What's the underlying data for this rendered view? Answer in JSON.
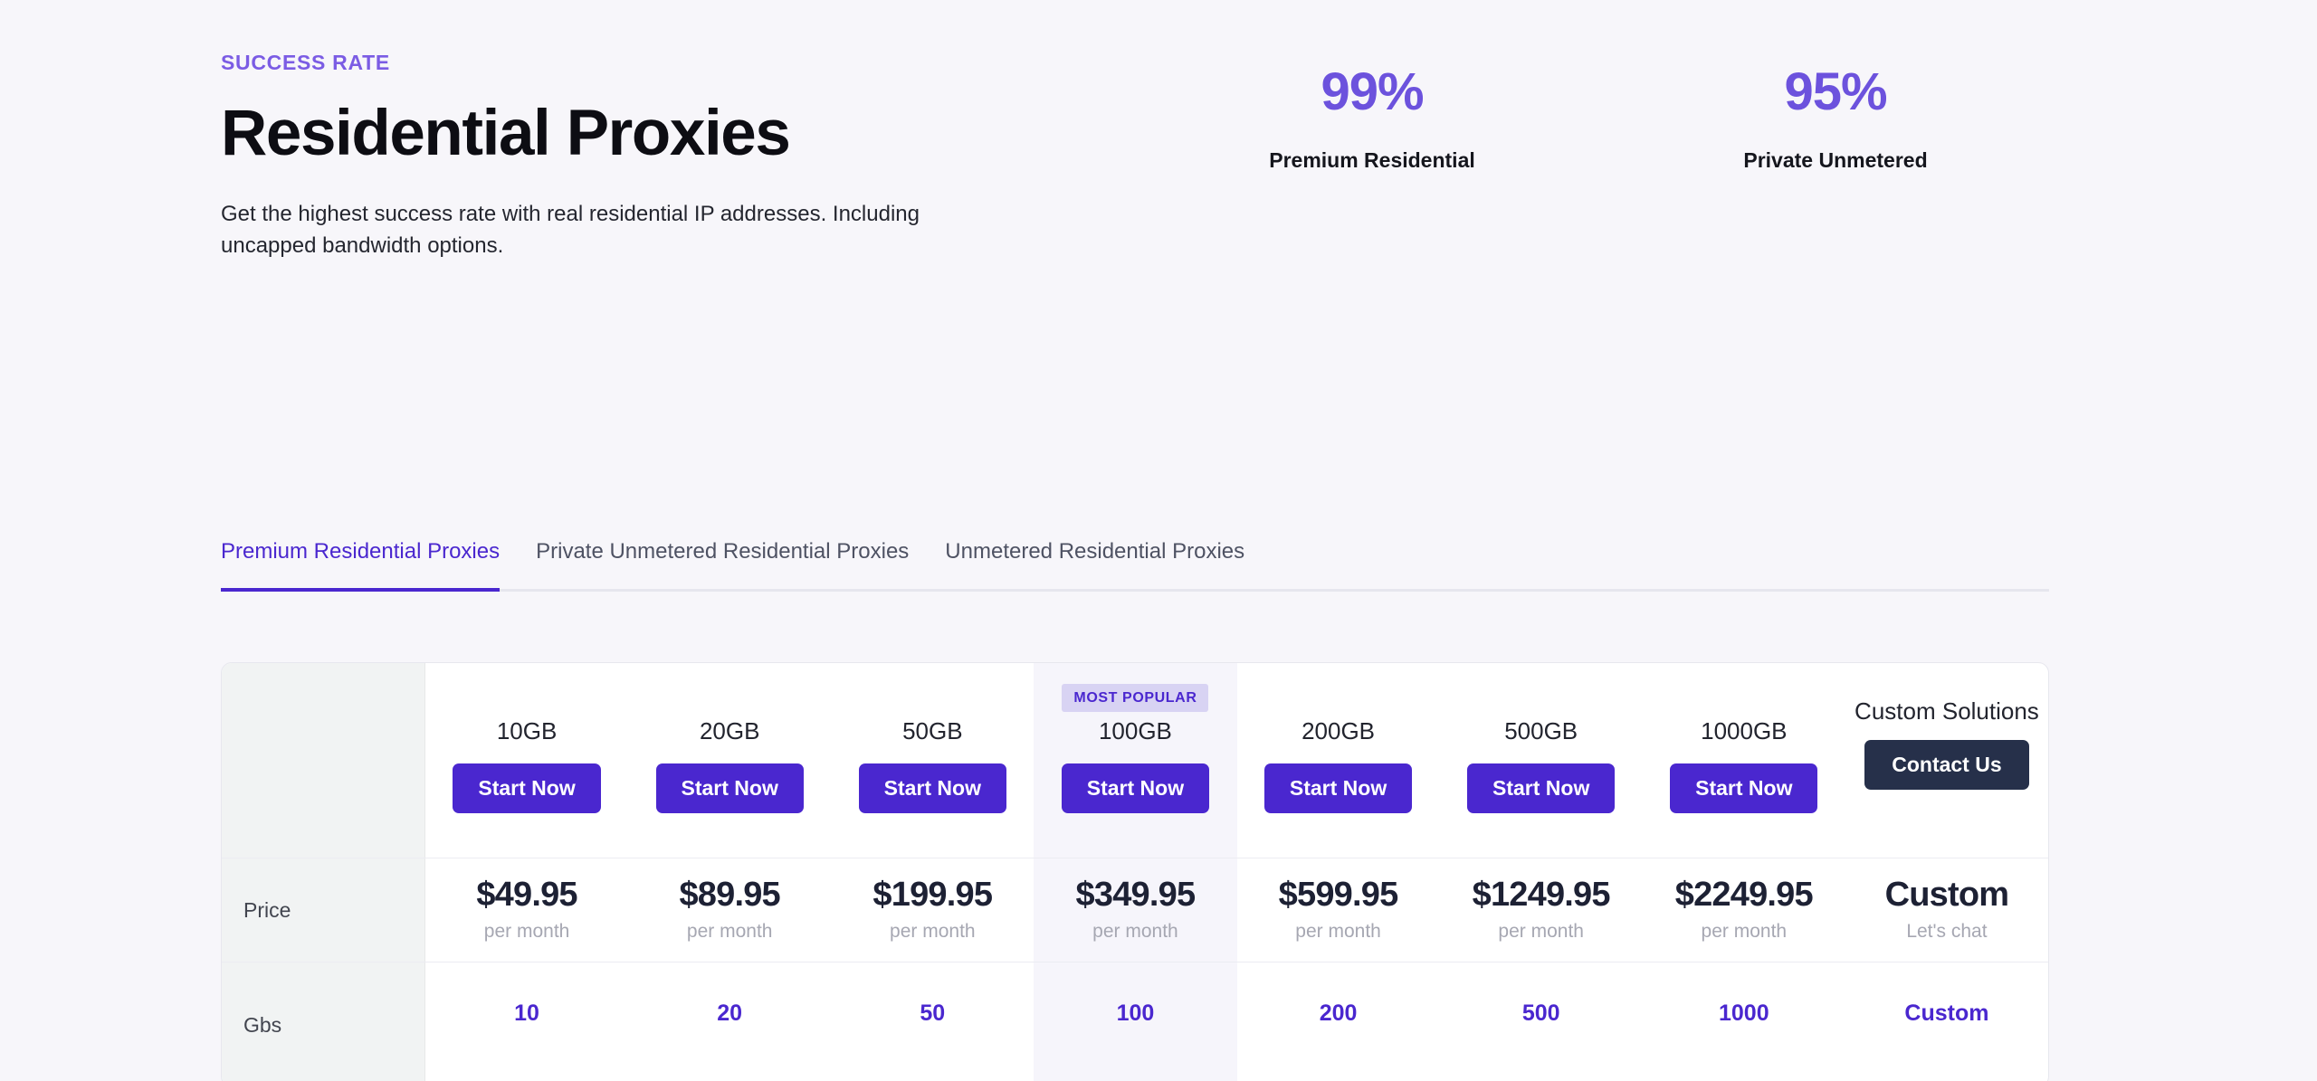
{
  "hero": {
    "eyebrow": "SUCCESS RATE",
    "title": "Residential Proxies",
    "subtitle": "Get the highest success rate with real residential IP addresses. Including uncapped bandwidth options.",
    "stats": [
      {
        "value": "99%",
        "label": "Premium Residential"
      },
      {
        "value": "95%",
        "label": "Private Unmetered"
      }
    ]
  },
  "tabs": [
    {
      "label": "Premium Residential Proxies",
      "active": true
    },
    {
      "label": "Private Unmetered Residential Proxies",
      "active": false
    },
    {
      "label": "Unmetered Residential Proxies",
      "active": false
    }
  ],
  "pricing_table": {
    "row_labels": {
      "header": "",
      "price": "Price",
      "gbs": "Gbs"
    },
    "popular_badge": "MOST POPULAR",
    "cta_label": "Start Now",
    "contact_label": "Contact Us",
    "per_month": "per month",
    "lets_chat": "Let's chat",
    "columns": [
      {
        "name": "10GB",
        "price": "$49.95",
        "price_sub": "per month",
        "gbs": "10",
        "popular": false,
        "cta": "Start Now",
        "cta_style": "primary"
      },
      {
        "name": "20GB",
        "price": "$89.95",
        "price_sub": "per month",
        "gbs": "20",
        "popular": false,
        "cta": "Start Now",
        "cta_style": "primary"
      },
      {
        "name": "50GB",
        "price": "$199.95",
        "price_sub": "per month",
        "gbs": "50",
        "popular": false,
        "cta": "Start Now",
        "cta_style": "primary"
      },
      {
        "name": "100GB",
        "price": "$349.95",
        "price_sub": "per month",
        "gbs": "100",
        "popular": true,
        "cta": "Start Now",
        "cta_style": "primary"
      },
      {
        "name": "200GB",
        "price": "$599.95",
        "price_sub": "per month",
        "gbs": "200",
        "popular": false,
        "cta": "Start Now",
        "cta_style": "primary"
      },
      {
        "name": "500GB",
        "price": "$1249.95",
        "price_sub": "per month",
        "gbs": "500",
        "popular": false,
        "cta": "Start Now",
        "cta_style": "primary"
      },
      {
        "name": "1000GB",
        "price": "$2249.95",
        "price_sub": "per month",
        "gbs": "1000",
        "popular": false,
        "cta": "Start Now",
        "cta_style": "primary"
      },
      {
        "name": "Custom Solutions",
        "price": "Custom",
        "price_sub": "Let's chat",
        "gbs": "Custom",
        "popular": false,
        "cta": "Contact Us",
        "cta_style": "dark"
      }
    ]
  },
  "colors": {
    "page_background": "#f7f6fa",
    "accent_purple": "#4a27cf",
    "eyebrow_purple": "#7b5ce4",
    "stat_purple": "#6c52dd",
    "badge_background": "#d8d3f3",
    "popular_column_background": "#f6f5fb",
    "label_column_background": "#f1f3f3",
    "dark_button": "#26304a",
    "price_text": "#1d2134",
    "muted_text": "#a6a7b2"
  }
}
